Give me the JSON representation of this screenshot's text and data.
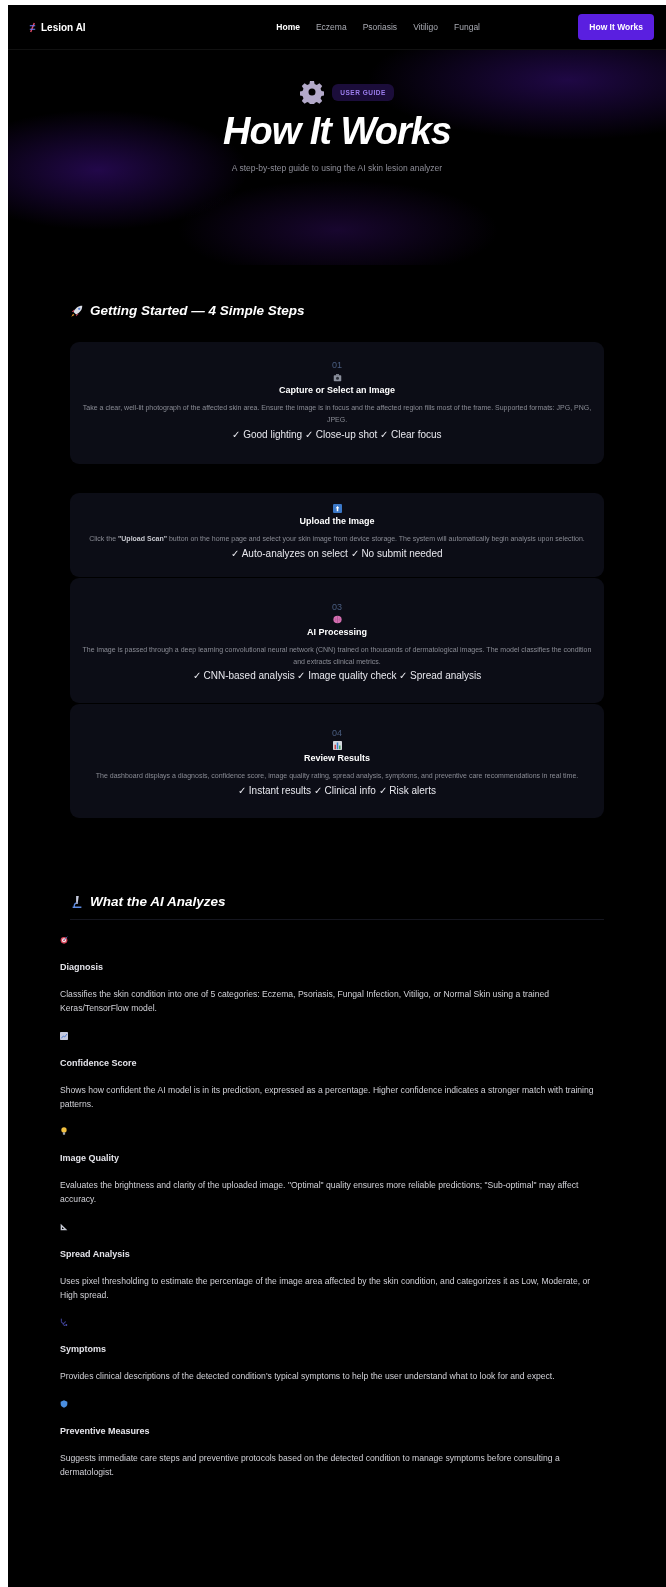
{
  "nav": {
    "brand": "Lesion AI",
    "links": [
      {
        "label": "Home",
        "selected": true
      },
      {
        "label": "Eczema",
        "selected": false
      },
      {
        "label": "Psoriasis",
        "selected": false
      },
      {
        "label": "Vitiligo",
        "selected": false
      },
      {
        "label": "Fungal",
        "selected": false
      }
    ],
    "cta": "How It Works"
  },
  "hero": {
    "badge": "USER GUIDE",
    "title": "How It Works",
    "subtitle": "A step-by-step guide to using the AI skin lesion analyzer"
  },
  "steps_section": {
    "heading": "Getting Started — 4 Simple Steps",
    "steps": [
      {
        "number": "01",
        "kind": "camera",
        "title": "Capture or Select an Image",
        "text": "Take a clear, well-lit photograph of the affected skin area. Ensure the image is in focus and the affected region fills most of the frame. Supported formats: JPG, PNG, JPEG.",
        "checks": "✓ Good lighting ✓ Close-up shot ✓ Clear focus"
      },
      {
        "kind": "upload",
        "title": "Upload the Image",
        "text": "Click the **\"Upload Scan\"** button on the home page and select your skin image from device storage. The system will automatically begin analysis upon selection.",
        "checks": "✓ Auto-analyzes on select ✓ No submit needed"
      },
      {
        "number": "03",
        "kind": "brain",
        "title": "AI Processing",
        "text": "The image is passed through a deep learning convolutional neural network (CNN) trained on thousands of dermatological images. The model classifies the condition and extracts clinical metrics.",
        "checks": "✓ CNN-based analysis ✓ Image quality check ✓ Spread analysis"
      },
      {
        "number": "04",
        "kind": "chart",
        "title": "Review Results",
        "text": "The dashboard displays a diagnosis, confidence score, image quality rating, spread analysis, symptoms, and preventive care recommendations in real time.",
        "checks": "✓ Instant results ✓ Clinical info ✓ Risk alerts"
      }
    ]
  },
  "analyzes_section": {
    "heading": "What the AI Analyzes",
    "items": [
      {
        "kind": "target",
        "title": "Diagnosis",
        "text": "Classifies the skin condition into one of 5 categories: Eczema, Psoriasis, Fungal Infection, Vitiligo, or Normal Skin using a trained Keras/TensorFlow model."
      },
      {
        "kind": "chart",
        "title": "Confidence Score",
        "text": "Shows how confident the AI model is in its prediction, expressed as a percentage. Higher confidence indicates a stronger match with training patterns."
      },
      {
        "kind": "bulb",
        "title": "Image Quality",
        "text": "Evaluates the brightness and clarity of the uploaded image. \"Optimal\" quality ensures more reliable predictions; \"Sub-optimal\" may affect accuracy."
      },
      {
        "kind": "ruler",
        "title": "Spread Analysis",
        "text": "Uses pixel thresholding to estimate the percentage of the image area affected by the skin condition, and categorizes it as Low, Moderate, or High spread."
      },
      {
        "kind": "stethoscope",
        "title": "Symptoms",
        "text": "Provides clinical descriptions of the detected condition's typical symptoms to help the user understand what to look for and expect."
      },
      {
        "kind": "shield",
        "title": "Preventive Measures",
        "text": "Suggests immediate care steps and preventive protocols based on the detected condition to manage symptoms before consulting a dermatologist."
      }
    ]
  }
}
